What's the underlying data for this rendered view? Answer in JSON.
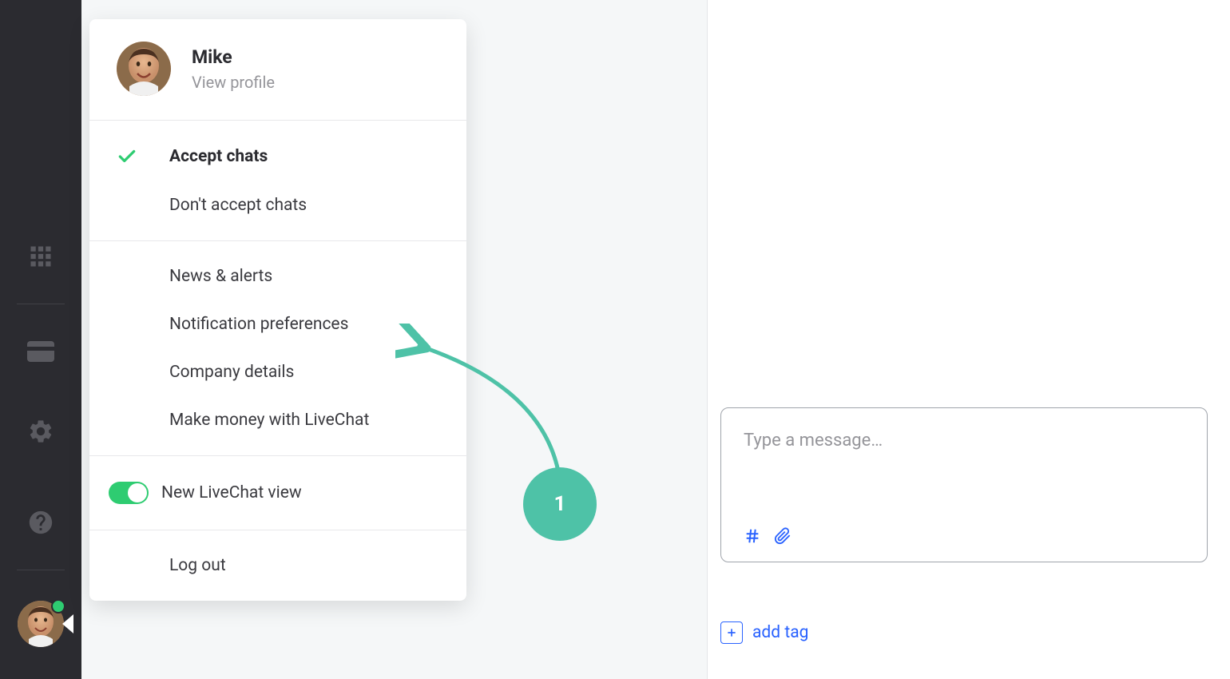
{
  "user": {
    "name": "Mike",
    "view_profile_label": "View profile"
  },
  "popup": {
    "accept_chats": "Accept chats",
    "dont_accept_chats": "Don't accept chats",
    "news_alerts": "News & alerts",
    "notification_preferences": "Notification preferences",
    "company_details": "Company details",
    "make_money": "Make money with LiveChat",
    "new_livechat_view": "New LiveChat view",
    "log_out": "Log out"
  },
  "message": {
    "placeholder": "Type a message…"
  },
  "tag": {
    "add_label": "add tag"
  },
  "annotation": {
    "step": "1"
  }
}
